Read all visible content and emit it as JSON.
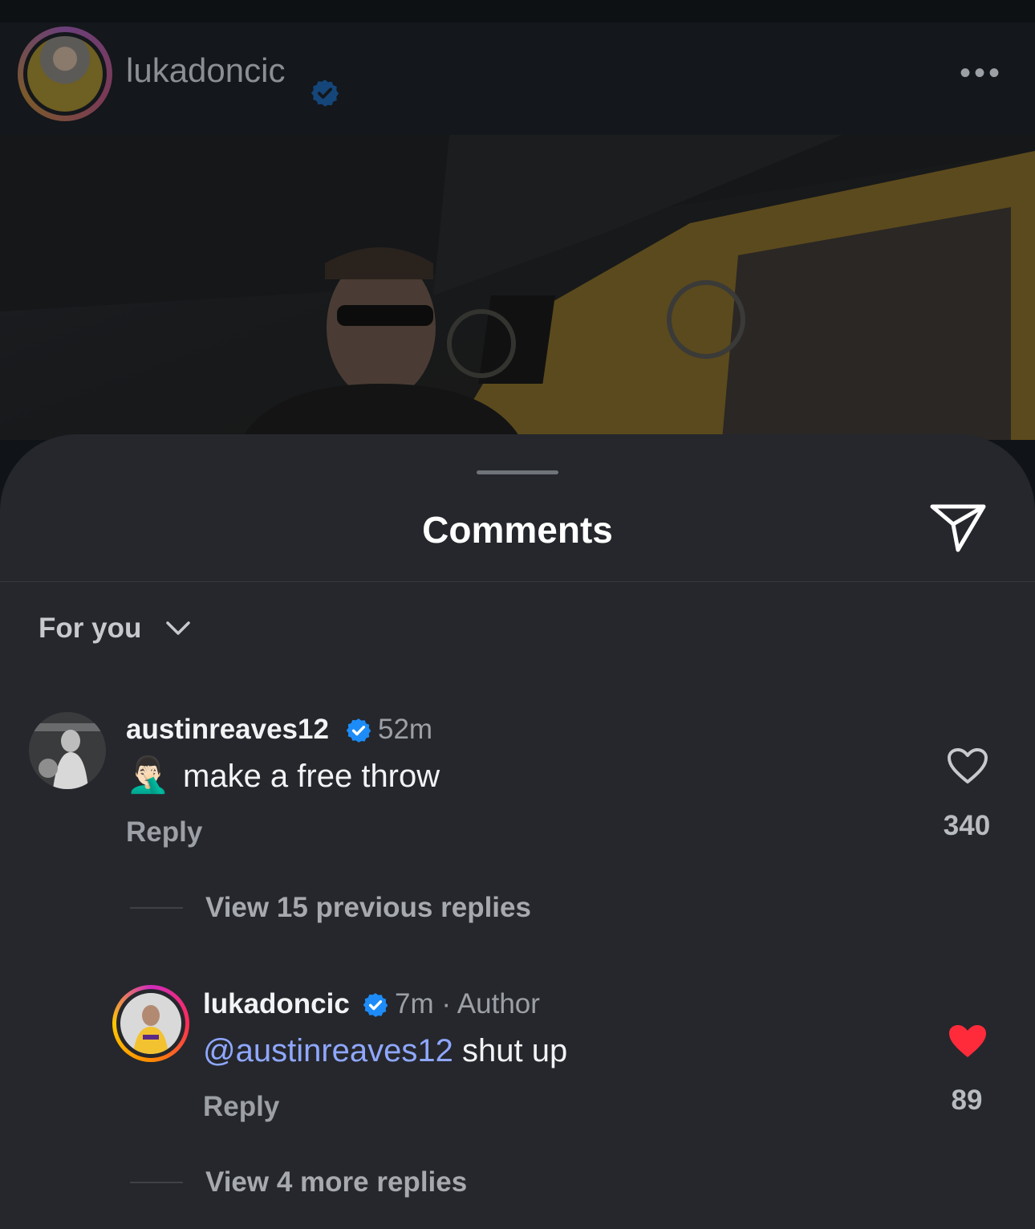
{
  "post": {
    "username": "lukadoncic",
    "more_label": "•••"
  },
  "sheet": {
    "title": "Comments",
    "sort_label": "For you"
  },
  "comments": [
    {
      "username": "austinreaves12",
      "time": "52m",
      "emoji": "🤦🏻‍♂️",
      "text": "make a free throw",
      "reply_label": "Reply",
      "likes": "340",
      "liked": false,
      "view_replies_label": "View 15 previous replies"
    }
  ],
  "replies": [
    {
      "username": "lukadoncic",
      "time": "7m · Author",
      "mention": "@austinreaves12",
      "text": " shut up",
      "reply_label": "Reply",
      "likes": "89",
      "liked": true,
      "view_more_label": "View 4 more replies"
    }
  ],
  "colors": {
    "verified": "#1d8cf8",
    "liked_heart": "#ff2b3a",
    "mention": "#8fa7ff"
  },
  "icons": [
    "verified-badge-icon",
    "more-icon",
    "share-send-icon",
    "chevron-down-icon",
    "heart-outline-icon",
    "heart-filled-icon"
  ]
}
